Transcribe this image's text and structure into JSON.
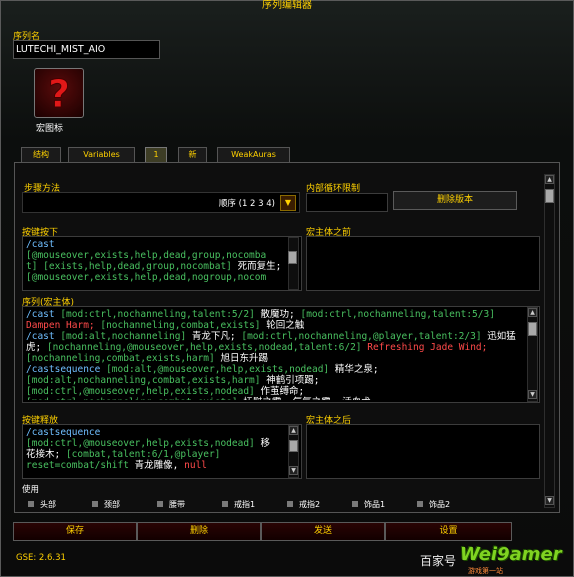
{
  "window_title": "序列编辑器",
  "sequence_name_label": "序列名",
  "sequence_name_value": "LUTECHI_MIST_AIO",
  "macro_icon_label": "宏图标",
  "tabs": [
    "结构",
    "Variables",
    "1",
    "新",
    "WeakAuras"
  ],
  "step_method": {
    "label": "步骤方法",
    "value": "顺序 (1 2 3 4)"
  },
  "inner_loop_label": "内部循环限制",
  "delete_version_button": "删除版本",
  "keypress": {
    "label": "按键按下",
    "lines": [
      [
        {
          "t": "/cast",
          "c": "cmd"
        }
      ],
      [
        {
          "t": "[@mouseover,exists,help,dead,group,nocomba",
          "c": "cond"
        }
      ],
      [
        {
          "t": "t] [exists,help,dead,group,nocombat]",
          "c": "cond"
        },
        {
          "t": " 死而复生;",
          "c": "txt"
        }
      ],
      [
        {
          "t": "[@mouseover,exists,help,dead,nogroup,nocom",
          "c": "cond"
        }
      ]
    ]
  },
  "pre_macro_label": "宏主体之前",
  "sequence_body": {
    "label": "序列(宏主体)",
    "lines": [
      [
        {
          "t": "/cast",
          "c": "cmd"
        },
        {
          "t": " [mod:ctrl,nochanneling,talent:5/2]",
          "c": "cond"
        },
        {
          "t": " 散魔功;",
          "c": "txt"
        },
        {
          "t": " [mod:ctrl,nochanneling,talent:5/3]",
          "c": "cond"
        }
      ],
      [
        {
          "t": "Dampen Harm;",
          "c": "red"
        },
        {
          "t": " [nochanneling,combat,exists]",
          "c": "cond"
        },
        {
          "t": " 轮回之触",
          "c": "txt"
        }
      ],
      [
        {
          "t": "/cast",
          "c": "cmd"
        },
        {
          "t": " [mod:alt,nochanneling]",
          "c": "cond"
        },
        {
          "t": " 青龙下凡;",
          "c": "txt"
        },
        {
          "t": " [mod:ctrl,nochanneling,@player,talent:2/3]",
          "c": "cond"
        },
        {
          "t": " 迅如猛",
          "c": "txt"
        }
      ],
      [
        {
          "t": "虎;",
          "c": "txt"
        },
        {
          "t": " [nochanneling,@mouseover,help,exists,nodead,talent:6/2]",
          "c": "cond"
        },
        {
          "t": " Refreshing Jade Wind;",
          "c": "red"
        }
      ],
      [
        {
          "t": "[nochanneling,combat,exists,harm]",
          "c": "cond"
        },
        {
          "t": " 旭日东升踢",
          "c": "txt"
        }
      ],
      [
        {
          "t": "/castsequence",
          "c": "cmd"
        },
        {
          "t": " [mod:alt,@mouseover,help,exists,nodead]",
          "c": "cond"
        },
        {
          "t": " 精华之泉;",
          "c": "txt"
        }
      ],
      [
        {
          "t": "[mod:alt,nochanneling,combat,exists,harm]",
          "c": "cond"
        },
        {
          "t": " 神鹤引项踢;",
          "c": "txt"
        }
      ],
      [
        {
          "t": "[mod:ctrl,@mouseover,help,exists,nodead]",
          "c": "cond"
        },
        {
          "t": " 作茧缚命;",
          "c": "txt"
        }
      ],
      [
        {
          "t": "[mod:ctrl,nochanneling,combat,exists]",
          "c": "cond"
        },
        {
          "t": " 抚慰之雾, 氤氲之雾, 活血术",
          "c": "txt"
        }
      ]
    ]
  },
  "keyrelease": {
    "label": "按键释放",
    "lines": [
      [
        {
          "t": "/castsequence",
          "c": "cmd"
        }
      ],
      [
        {
          "t": "[mod:ctrl,@mouseover,help,exists,nodead]",
          "c": "cond"
        },
        {
          "t": " 移",
          "c": "txt"
        }
      ],
      [
        {
          "t": "花接木;",
          "c": "txt"
        },
        {
          "t": " [combat,talent:6/1,@player]",
          "c": "cond"
        }
      ],
      [
        {
          "t": "reset=combat/shift",
          "c": "cond"
        },
        {
          "t": "  青龙雕像,",
          "c": "txt"
        },
        {
          "t": " null",
          "c": "red"
        }
      ]
    ]
  },
  "post_macro_label": "宏主体之后",
  "use_label": "使用",
  "use_items": [
    "头部",
    "颈部",
    "腰带",
    "戒指1",
    "戒指2",
    "饰品1",
    "饰品2"
  ],
  "bottom_buttons": [
    "保存",
    "删除",
    "发送",
    "设置"
  ],
  "version_text": "GSE: 2.6.31",
  "watermark": {
    "prefix": "百家号",
    "brand": "Wei9amer",
    "sub": "游戏第一站"
  }
}
